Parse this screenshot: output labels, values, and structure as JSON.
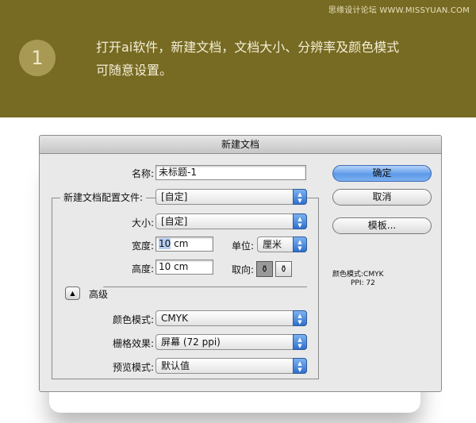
{
  "banner": {
    "watermark": "思缘设计论坛  WWW.MISSYUAN.COM",
    "step_number": "1",
    "step_line1": "打开ai软件，新建文档，文档大小、分辨率及颜色模式",
    "step_line2": "可随意设置。",
    "background_color": "#776a22"
  },
  "dialog": {
    "title": "新建文档",
    "name_label": "名称:",
    "name_value": "未标题-1",
    "profile_label": "新建文档配置文件:",
    "profile_value": "[自定]",
    "size_label": "大小:",
    "size_value": "[自定]",
    "width_label": "宽度:",
    "width_number": "10",
    "width_unit_text": " cm",
    "height_label": "高度:",
    "height_value": "10 cm",
    "units_label": "单位:",
    "units_value": "厘米",
    "orientation_label": "取向:",
    "advanced_label": "高级",
    "color_mode_label": "颜色模式:",
    "color_mode_value": "CMYK",
    "raster_label": "栅格效果:",
    "raster_value": "屏幕 (72 ppi)",
    "preview_label": "预览模式:",
    "preview_value": "默认值",
    "ok_button": "确定",
    "cancel_button": "取消",
    "templates_button": "模板...",
    "info_color_mode": "颜色模式:CMYK",
    "info_ppi": "PPI: 72",
    "accent_color": "#5d9ae8"
  },
  "icons": {
    "popup_arrows": "updown-arrows-icon",
    "disclosure": "triangle-up-icon",
    "portrait": "portrait-orientation-icon",
    "landscape": "landscape-orientation-icon"
  }
}
